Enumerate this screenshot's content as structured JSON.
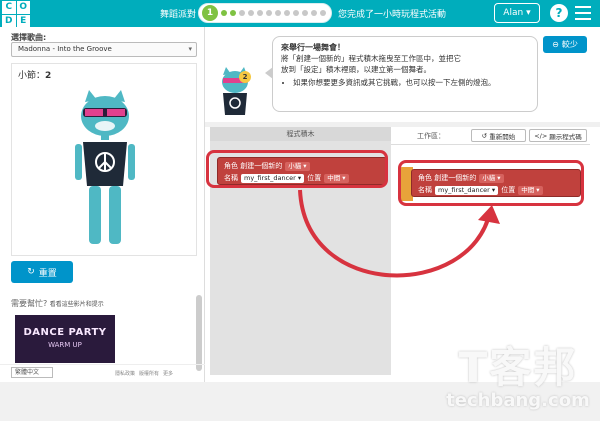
{
  "header": {
    "logo_letters": [
      "C",
      "O",
      "D",
      "E"
    ],
    "puzzle_title": "舞蹈派對",
    "current_level": "1",
    "status_message": "您完成了一小時玩程式活動",
    "user_name": "Alan",
    "help_icon": "question-icon",
    "menu_icon": "hamburger-icon",
    "brand_color": "#00adbc"
  },
  "left_panel": {
    "song_label": "選擇歌曲:",
    "song_selected": "Madonna - Into the Groove",
    "measure_label": "小節：",
    "measure_value": "2",
    "reset_label": "重置",
    "help_title": "需要幫忙?",
    "help_subtitle": "看看這些影片和提示",
    "video_title": "DANCE PARTY",
    "video_subtitle": "WARM UP",
    "language": "繁體中文",
    "footer_links": [
      "隱私政策",
      "版權所有",
      "更多"
    ]
  },
  "instructions": {
    "line1": "來舉行一場舞會！",
    "line2": "將「創建一個新的」程式積木拖曳至工作區中，並把它",
    "line3": "放到「設定」積木裡頭，以建立第一個舞者。",
    "bullet": "如果你想要更多資訊或其它挑戰，也可以按一下左側的燈泡。",
    "hint_badge": "2",
    "less_label": "較少"
  },
  "toolbox": {
    "header": "程式積木",
    "block": {
      "line1_prefix": "角色 創建一個新的",
      "character": "小貓",
      "name_label": "名稱",
      "name_value": "my_first_dancer",
      "position_label": "位置",
      "position_value": "中間"
    }
  },
  "workspace": {
    "label": "工作區：",
    "restart_label": "重新開始",
    "show_code_label": "顯示程式碼",
    "block": {
      "line1_prefix": "角色 創建一個新的",
      "character": "小貓",
      "name_label": "名稱",
      "name_value": "my_first_dancer",
      "position_label": "位置",
      "position_value": "中間"
    }
  },
  "watermark": {
    "big": "T客邦",
    "small": "techbang.com"
  },
  "colors": {
    "block_red": "#c0413d",
    "highlight": "#d7333f",
    "button_blue": "#0094ca"
  }
}
